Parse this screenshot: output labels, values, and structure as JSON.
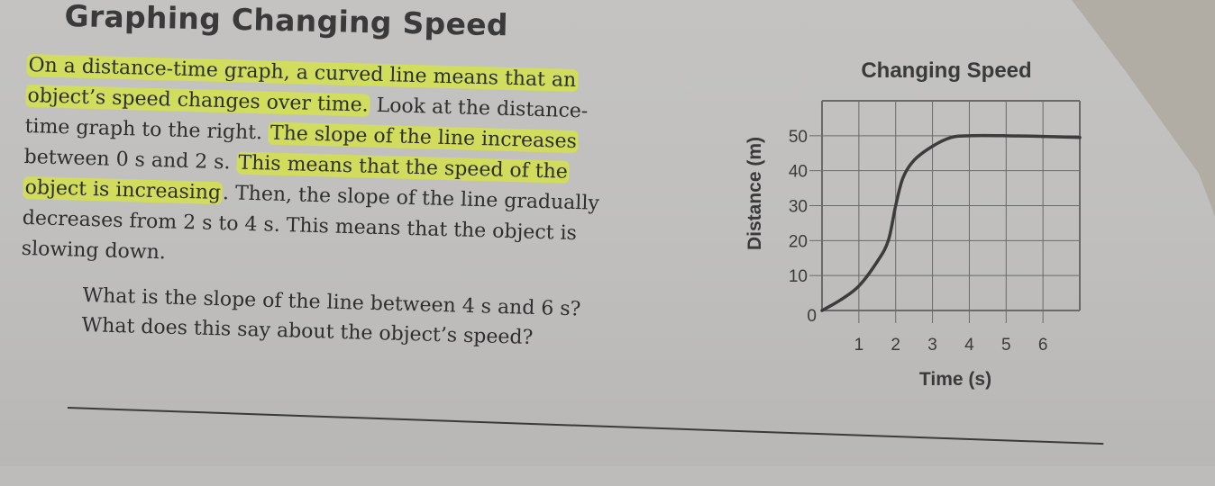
{
  "page": {
    "heading": "Graphing Changing Speed",
    "paragraph_lines": [
      {
        "text": "On a distance-time graph, a curved line means that an",
        "highlighted": true
      },
      {
        "text": "object’s speed changes over time. Look at the distance-",
        "highlighted_part": "object’s speed changes over time.",
        "rest": " Look at the distance-"
      },
      {
        "text": "time graph to the right. The slope of the line increases",
        "plain_part": "time graph to the right. ",
        "highlighted_part": "The slope of the line increases"
      },
      {
        "text": "between 0 s and 2 s. This means that the speed of the",
        "plain_part": "between 0 s and 2 s. ",
        "highlighted_part": "This means that the speed of the"
      },
      {
        "text": "object is increasing. Then, the slope of the line gradually",
        "highlighted_part": "object is increasing",
        "rest": ". Then, the slope of the line gradually"
      },
      {
        "text": "decreases from 2 s to 4 s. This means that the object is"
      },
      {
        "text": "slowing down."
      }
    ],
    "question_lines": [
      "What is the slope of the line between 4 s and 6 s?",
      "What does this say about the object’s speed?"
    ],
    "highlight_color": "#d6e63c"
  },
  "chart_data": {
    "type": "line",
    "title": "Changing Speed",
    "xlabel": "Time (s)",
    "ylabel": "Distance (m)",
    "x_ticks": [
      "1",
      "2",
      "3",
      "4",
      "5",
      "6"
    ],
    "y_ticks": [
      "0",
      "10",
      "20",
      "30",
      "40",
      "50"
    ],
    "xlim": [
      0,
      7
    ],
    "ylim": [
      0,
      60
    ],
    "grid": true,
    "series": [
      {
        "name": "distance",
        "x": [
          0,
          0.5,
          1,
          1.5,
          1.8,
          2,
          2.2,
          2.5,
          3,
          3.5,
          4,
          5,
          6,
          7
        ],
        "y": [
          0,
          3,
          7,
          14,
          20,
          30,
          38,
          43,
          47,
          49.5,
          50,
          50,
          49.8,
          49.5
        ]
      }
    ],
    "line_color": "#3c3c3c"
  }
}
